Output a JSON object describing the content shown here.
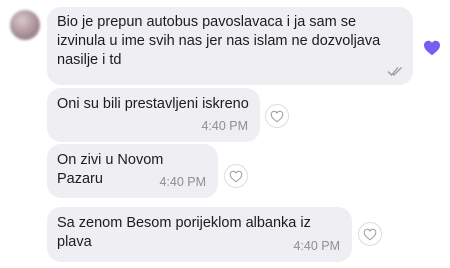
{
  "messages": [
    {
      "text": "Bio je prepun autobus pavoslavaca i ja sam se izvinula u ime svih nas jer nas islam ne dozvoljava nasilje i td",
      "status_icon": "seen-check-icon",
      "liked": true
    },
    {
      "text": "Oni su bili prestavljeni iskreno",
      "time": "4:40 PM"
    },
    {
      "text": "On zivi u Novom Pazaru",
      "time": "4:40 PM"
    },
    {
      "text": "Sa zenom Besom porijeklom albanka iz plava",
      "time": "4:40 PM"
    }
  ],
  "colors": {
    "bubble": "#efeef2",
    "text": "#1c1c1c",
    "timestamp": "#8e8e94",
    "like_accent": "#7360f2"
  }
}
